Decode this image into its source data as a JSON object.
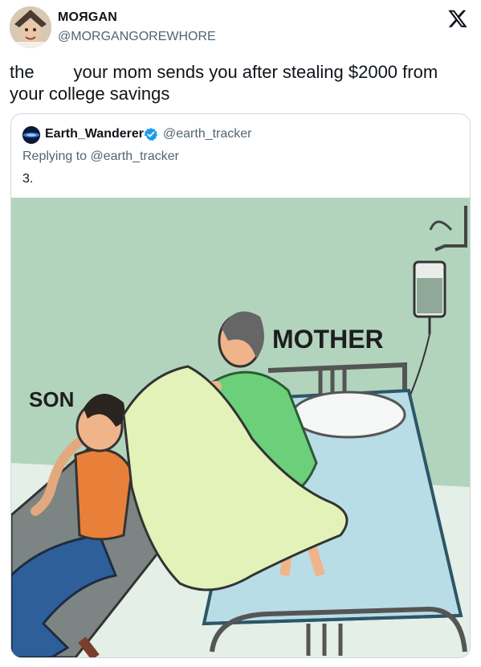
{
  "header": {
    "display_name": "MOЯGAN",
    "handle": "@MORGANGOREWHORE",
    "platform_icon": "x-logo-icon"
  },
  "tweet": {
    "text": "the        your mom sends you after stealing $2000 from your college savings"
  },
  "quoted_tweet": {
    "display_name": "Earth_Wanderer",
    "verified_icon": "verified-badge-icon",
    "handle": "@earth_tracker",
    "replying_to": "Replying to @earth_tracker",
    "body": "3.",
    "image": {
      "label_mother": "MOTHER",
      "label_son": "SON"
    }
  },
  "colors": {
    "text_primary": "#0f1419",
    "text_secondary": "#536471",
    "border": "#cfd9de",
    "verified": "#1d9bf0",
    "wall": "#b2d4bd",
    "floor": "#dfeee6",
    "bed_sheet": "#b8dde6",
    "blanket": "#e2f2b8",
    "mother_dress": "#6ccf7a",
    "son_shirt": "#e8803a",
    "son_jeans": "#2e5f9a"
  }
}
